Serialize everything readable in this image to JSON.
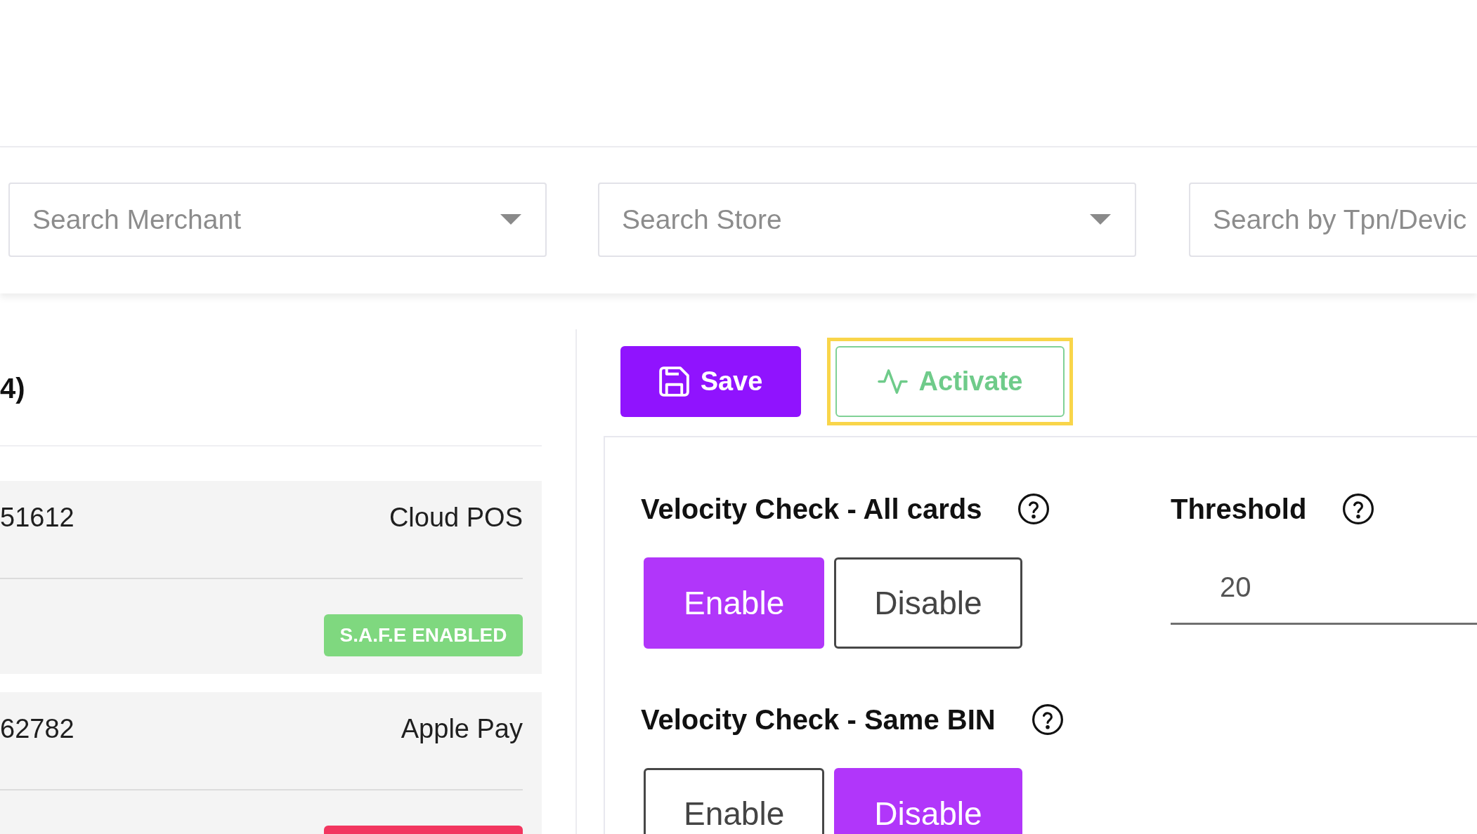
{
  "filters": [
    {
      "kind": "dropdown",
      "placeholder": "Search Merchant"
    },
    {
      "kind": "dropdown",
      "placeholder": "Search Store"
    },
    {
      "kind": "text",
      "placeholder": "Search by Tpn/Devic"
    }
  ],
  "device_list": {
    "heading": "4)",
    "rows": [
      {
        "column_1": "51612",
        "column_2": "Cloud POS",
        "badge": {
          "text": "S.A.F.E ENABLED",
          "color": "#7fd87f"
        }
      },
      {
        "column_1": "62782",
        "column_2": "Apple Pay",
        "badge": {
          "color": "#f2365f"
        }
      }
    ]
  },
  "toolbar": {
    "buttons": [
      {
        "label": "Save",
        "kind": "primary",
        "focused": false
      },
      {
        "label": "Activate",
        "kind": "outline",
        "focused": true
      }
    ]
  },
  "settings": {
    "toggles": [
      {
        "label": "Velocity Check - All cards",
        "options": [
          {
            "label": "Enable",
            "selected": true
          },
          {
            "label": "Disable",
            "selected": false
          }
        ]
      },
      {
        "label": "Velocity Check - Same BIN",
        "options": [
          {
            "label": "Enable",
            "selected": false
          },
          {
            "label": "Disable",
            "selected": true
          }
        ]
      }
    ],
    "threshold": {
      "label": "Threshold",
      "value": "20"
    }
  }
}
